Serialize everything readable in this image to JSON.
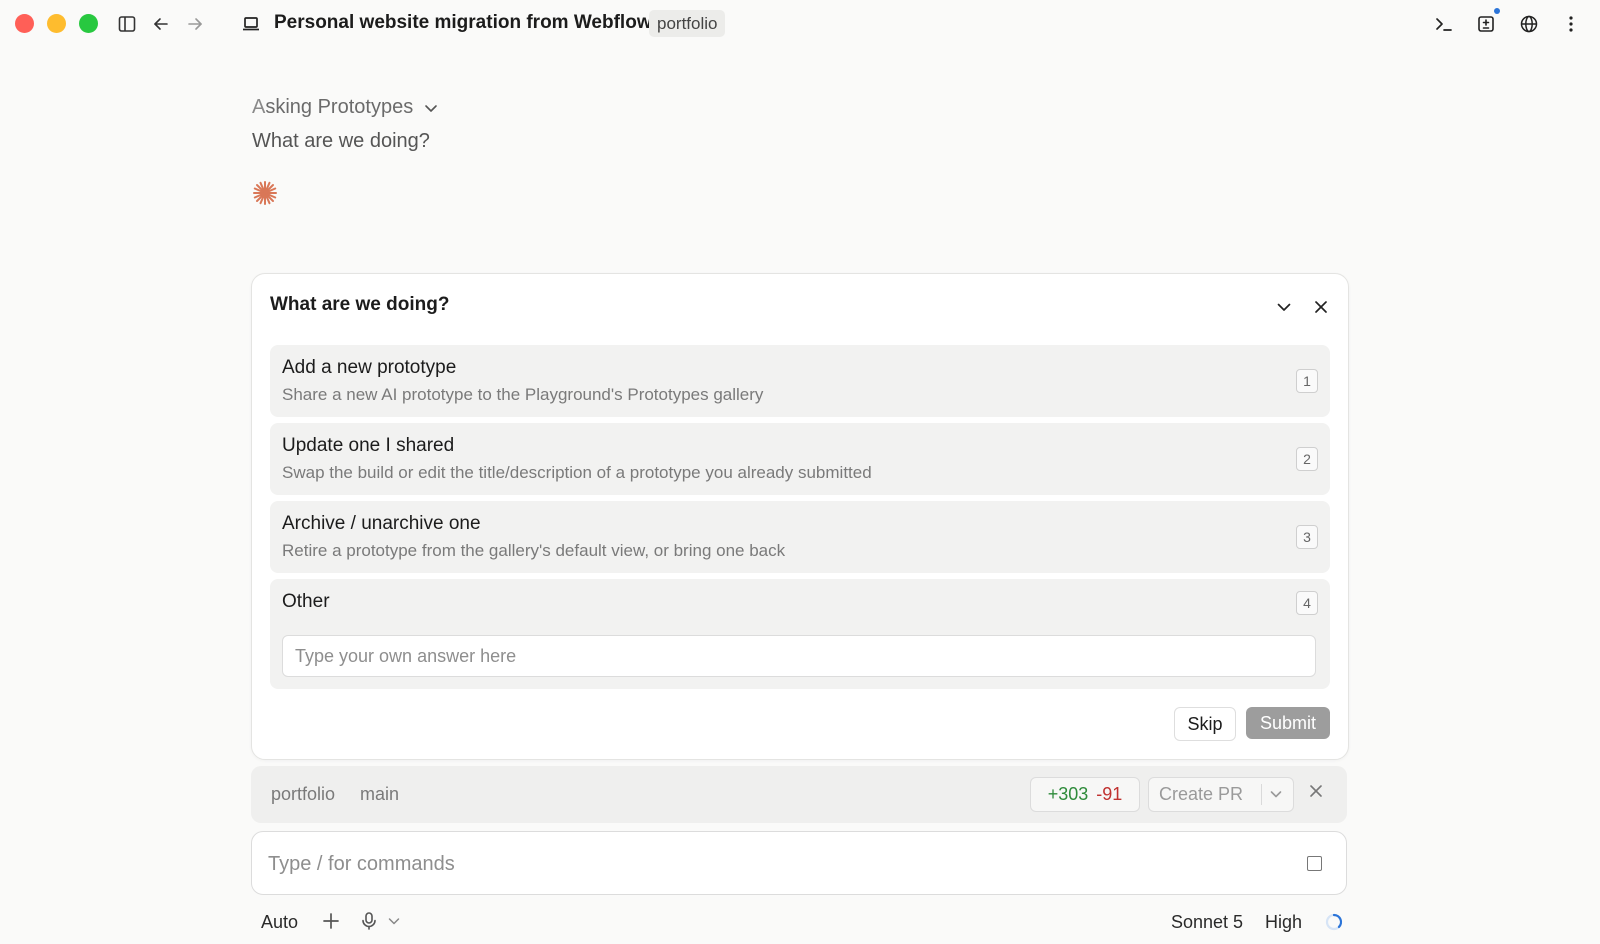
{
  "window": {
    "title": "Personal website migration from Webflow",
    "repo_badge": "portfolio"
  },
  "header": {
    "status_lead": "A",
    "status_rest": "sking Prototypes",
    "question": "What are we doing?"
  },
  "card": {
    "title": "What are we doing?",
    "options": [
      {
        "label": "Add a new prototype",
        "description": "Share a new AI prototype to the Playground's Prototypes gallery",
        "key": "1"
      },
      {
        "label": "Update one I shared",
        "description": "Swap the build or edit the title/description of a prototype you already submitted",
        "key": "2"
      },
      {
        "label": "Archive / unarchive one",
        "description": "Retire a prototype from the gallery's default view, or bring one back",
        "key": "3"
      },
      {
        "label": "Other",
        "key": "4",
        "placeholder": "Type your own answer here"
      }
    ],
    "skip_label": "Skip",
    "submit_label": "Submit"
  },
  "branch_bar": {
    "repo": "portfolio",
    "branch": "main",
    "additions": "+303",
    "deletions": "-91",
    "create_pr": "Create PR"
  },
  "composer": {
    "placeholder": "Type / for commands"
  },
  "toolbar": {
    "mode": "Auto",
    "model": "Sonnet 5",
    "effort": "High"
  },
  "colors": {
    "close": "#ff5f57",
    "minimize": "#febc2e",
    "maximize": "#28c840",
    "accent_spark": "#d97757",
    "additions": "#2e8b3a",
    "deletions": "#c0312f",
    "notification_dot": "#2b74d8"
  },
  "icons": [
    "sidebar-toggle-icon",
    "back-arrow-icon",
    "forward-arrow-icon",
    "laptop-icon",
    "terminal-icon",
    "diff-panel-icon",
    "globe-icon",
    "more-vertical-icon",
    "chevron-down-icon",
    "close-icon",
    "spark-icon",
    "plus-icon",
    "microphone-icon",
    "stop-icon",
    "loading-spinner-icon"
  ]
}
